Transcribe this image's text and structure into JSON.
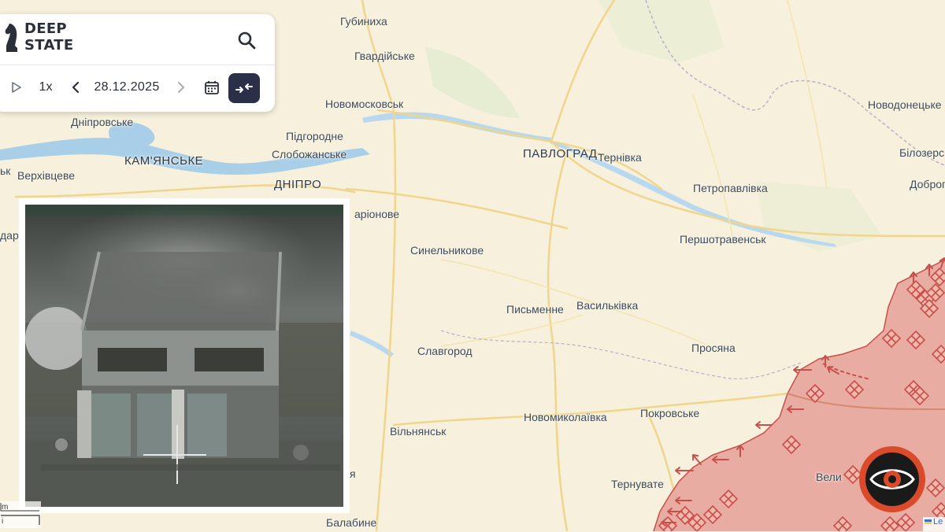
{
  "app": {
    "logo_line1": "DEEP",
    "logo_line2": "STATE"
  },
  "timeline": {
    "speed": "1x",
    "date": "28.12.2025"
  },
  "map": {
    "places": [
      {
        "name": "Губиниха"
      },
      {
        "name": "Гвардійське"
      },
      {
        "name": "Новомосковськ"
      },
      {
        "name": "Дніпровське"
      },
      {
        "name": "Підгородне"
      },
      {
        "name": "Слобожанське"
      },
      {
        "name": "КАМ'ЯНСЬКЕ",
        "major": true
      },
      {
        "name": "ДНІПРО",
        "major": true
      },
      {
        "name": "Верхівцеве"
      },
      {
        "name": "ПАВЛОГРАД",
        "major": true
      },
      {
        "name": "Тернівка"
      },
      {
        "name": "Новодонецьке"
      },
      {
        "name": "Білозерс"
      },
      {
        "name": "Доброп"
      },
      {
        "name": "Петропавлівка"
      },
      {
        "name": "аріонове"
      },
      {
        "name": "Синельникове"
      },
      {
        "name": "Першотравенськ"
      },
      {
        "name": "Письменне"
      },
      {
        "name": "Васильківка"
      },
      {
        "name": "Славгород"
      },
      {
        "name": "Просяна"
      },
      {
        "name": "Новомиколаївка"
      },
      {
        "name": "Покровське"
      },
      {
        "name": "Вільнянськ"
      },
      {
        "name": "Тернувате"
      },
      {
        "name": "Балабине"
      },
      {
        "name": "Вели"
      },
      {
        "name": "я"
      },
      {
        "name": "ьк"
      },
      {
        "name": "дар"
      }
    ],
    "scale_label_1": "m",
    "scale_label_2": "i",
    "attribution": "Le",
    "colors": {
      "background": "#f6f0dc",
      "occupied": "#e8a49c",
      "occupied_border": "#c8504a",
      "water": "#a9cfe8",
      "roads": "#f2d68a"
    }
  }
}
